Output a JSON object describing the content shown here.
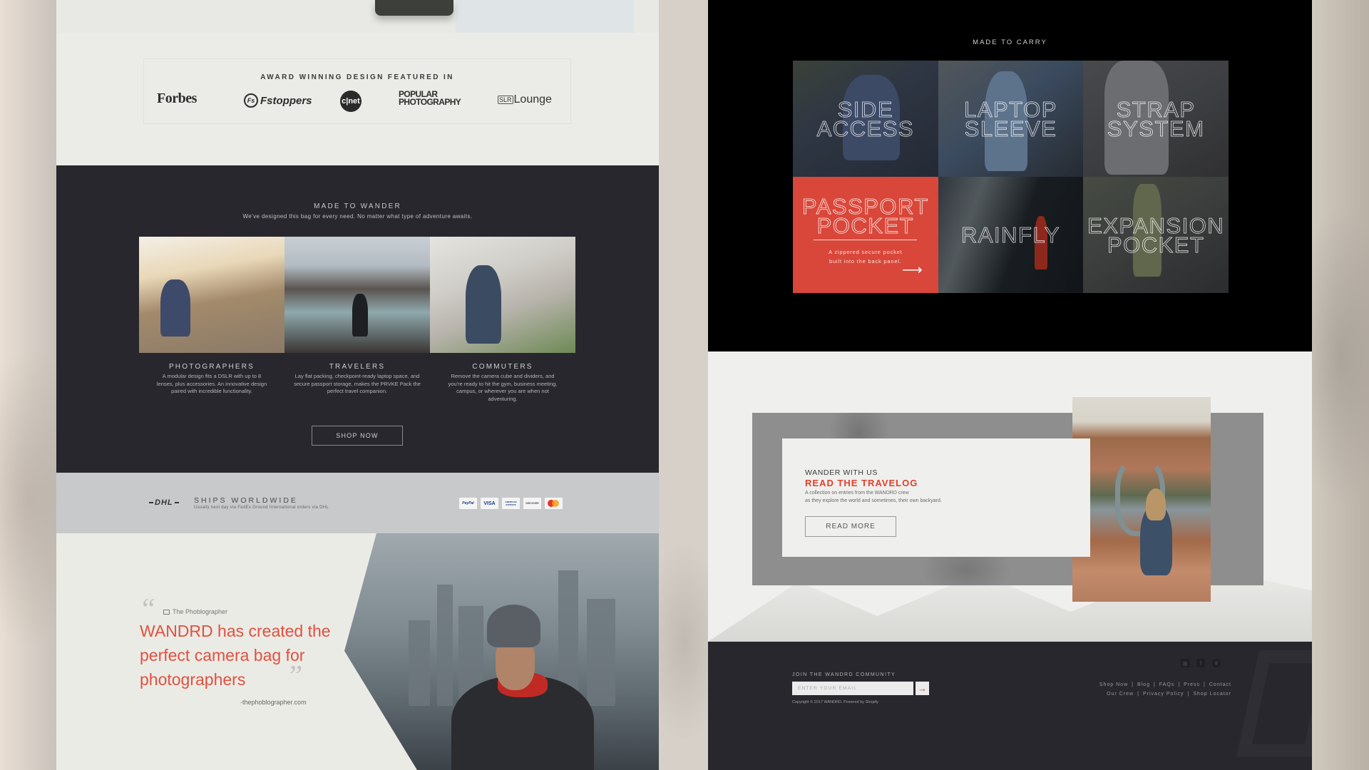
{
  "left_page": {
    "press": {
      "title": "AWARD WINNING DESIGN FEATURED IN",
      "logos": [
        {
          "name": "Forbes",
          "text": "Forbes"
        },
        {
          "name": "Fstoppers",
          "mark": "Fs",
          "text": "Fstoppers"
        },
        {
          "name": "CNET",
          "text": "c|net"
        },
        {
          "name": "Popular Photography",
          "line1": "POPULAR",
          "line2": "PHOTOGRAPHY"
        },
        {
          "name": "SLR Lounge",
          "mark": "SLR",
          "text": "Lounge"
        }
      ]
    },
    "wander": {
      "title": "MADE TO WANDER",
      "subtitle": "We've designed this bag for every need. No matter what type of adventure awaits.",
      "columns": [
        {
          "title": "PHOTOGRAPHERS",
          "text": "A modular design fits a DSLR with up to 8 lenses, plus accessories. An innovative design paired with incredible functionality."
        },
        {
          "title": "TRAVELERS",
          "text": "Lay flat packing, checkpoint-ready laptop space, and secure passport storage, makes the PRVKE Pack the perfect travel companion."
        },
        {
          "title": "COMMUTERS",
          "text": "Remove the camera cube and dividers, and you're ready to hit the gym, business meeting, campus, or wherever you are when not adventuring."
        }
      ],
      "shop_button": "SHOP NOW"
    },
    "shipping": {
      "carrier_logo": "DHL",
      "title": "SHIPS WORLDWIDE",
      "subtitle": "Usually next day via FedEx Ground International orders via DHL",
      "payments": [
        "PayPal",
        "VISA",
        "AMERICAN EXPRESS",
        "DISCOVER",
        "MasterCard"
      ]
    },
    "quote": {
      "open_mark": "“",
      "close_mark": "”",
      "source": "The Phoblographer",
      "text": "WANDRD has created the perfect camera bag for photographers",
      "attribution": "-thephoblographer.com"
    }
  },
  "right_page": {
    "carry": {
      "title": "MADE TO CARRY",
      "tiles": [
        {
          "label": "SIDE\nACCESS"
        },
        {
          "label": "LAPTOP\nSLEEVE"
        },
        {
          "label": "STRAP\nSYSTEM"
        },
        {
          "label": "PASSPORT\nPOCKET",
          "description_line1": "A zippered secure pocket",
          "description_line2": "built into the back panel.",
          "arrow": "⟶"
        },
        {
          "label": "RAINFLY"
        },
        {
          "label": "EXPANSION\nPOCKET"
        }
      ]
    },
    "travelog": {
      "kicker": "WANDER WITH US",
      "title": "READ THE TRAVELOG",
      "description_line1": "A collection on entries from the WANDRD crew",
      "description_line2": "as they explore the world and sometimes, their own backyard.",
      "button": "READ MORE"
    },
    "footer": {
      "join_label": "JOIN THE WANDRD COMMUNITY",
      "email_placeholder": "ENTER YOUR EMAIL",
      "submit_arrow": "→",
      "copyright": "Copyright © 2017 WANDRD. Powered by Shopify",
      "socials": [
        "instagram",
        "facebook",
        "twitter"
      ],
      "links_row1": [
        "Shop Now",
        "Blog",
        "FAQs",
        "Press",
        "Contact"
      ],
      "links_row2": [
        "Our Crew",
        "Privacy Policy",
        "Shop Locator"
      ],
      "separator": "|"
    }
  },
  "colors": {
    "accent_red": "#e1402d",
    "dark_bg": "#28272d",
    "black_bg": "#000000",
    "light_bg": "#ebebe7"
  }
}
